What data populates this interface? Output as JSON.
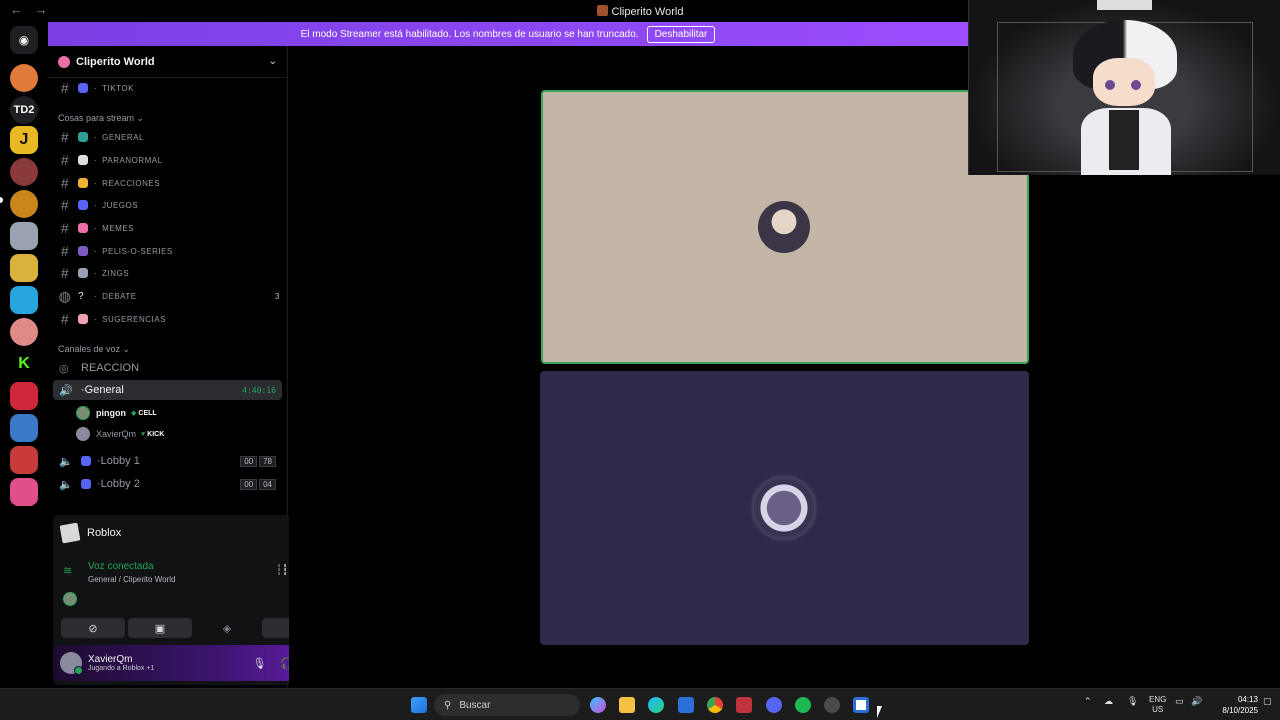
{
  "window": {
    "title": "Cliperito World",
    "nav": "← →"
  },
  "banner": {
    "text": "El modo Streamer está habilitado. Los nombres de usuario se han truncado.",
    "button": "Deshabilitar"
  },
  "servers": {
    "td2": "TD2",
    "j": "J",
    "k": "K"
  },
  "guild": {
    "name": "Cliperito World"
  },
  "channels_top": [
    {
      "label": "TIKTOK"
    }
  ],
  "category1": "Cosas para stream ⌄",
  "channels": [
    {
      "label": "GENERAL",
      "emoji_color": "#2aa198"
    },
    {
      "label": "PARANORMAL",
      "emoji_color": "#e0e0e0"
    },
    {
      "label": "REACCIONES",
      "emoji_color": "#f0b232"
    },
    {
      "label": "JUEGOS",
      "emoji_color": "#5865f2"
    },
    {
      "label": "MEMES",
      "emoji_color": "#eb6fa6"
    },
    {
      "label": "PELIS-O-SERIES",
      "emoji_color": "#7c5cc4"
    },
    {
      "label": "ZINGS",
      "emoji_color": "#9aa0b8"
    },
    {
      "label": "DEBATE",
      "emoji_color": "#f2f3f5",
      "count": "3"
    },
    {
      "label": "SUGERENCIAS",
      "emoji_color": "#f0a0b0"
    }
  ],
  "category2": "Canales de voz ⌄",
  "voice_channels": {
    "reaccion": "REACCION",
    "general": {
      "label": "General",
      "timer": "4:40:16"
    },
    "users": [
      {
        "name": "pingon",
        "tag": "CELL"
      },
      {
        "name": "XavierQm",
        "tag": "KICK"
      }
    ],
    "lobby1": {
      "label": "Lobby 1",
      "a": "00",
      "b": "78"
    },
    "lobby2": {
      "label": "Lobby 2",
      "a": "00",
      "b": "04"
    }
  },
  "panel": {
    "activity": "Roblox",
    "voice_status": "Voz conectada",
    "voice_sub": "General / Cliperito World"
  },
  "user": {
    "name": "XavierQm",
    "status": "Jugando a Roblox +1"
  },
  "taskbar": {
    "search_placeholder": "Buscar",
    "lang1": "ENG",
    "lang2": "US",
    "time": "04:13",
    "date": "8/10/2025"
  },
  "colors": {
    "accent": "#9b4dff",
    "green": "#23a559",
    "tile1": "#c4b6a6",
    "tile2": "#2e2a4a"
  }
}
